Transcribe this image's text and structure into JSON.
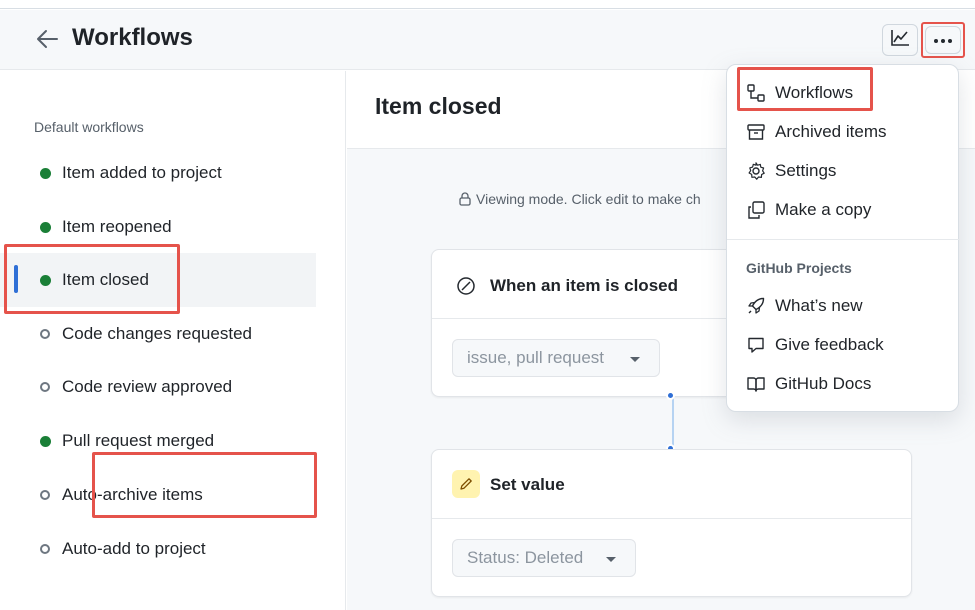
{
  "header": {
    "title": "Workflows",
    "back_icon": "arrow-left-icon",
    "insights_icon": "graph-icon",
    "more_icon": "kebab-horizontal-icon"
  },
  "sidebar": {
    "section_label": "Default workflows",
    "items": [
      {
        "label": "Item added to project",
        "enabled": true
      },
      {
        "label": "Item reopened",
        "enabled": true
      },
      {
        "label": "Item closed",
        "enabled": true,
        "active": true
      },
      {
        "label": "Code changes requested",
        "enabled": false
      },
      {
        "label": "Code review approved",
        "enabled": false
      },
      {
        "label": "Pull request merged",
        "enabled": true
      },
      {
        "label": "Auto-archive items",
        "enabled": false
      },
      {
        "label": "Auto-add to project",
        "enabled": false
      }
    ]
  },
  "main": {
    "title": "Item closed",
    "viewing_mode": "Viewing mode. Click edit to make ch",
    "trigger_card": {
      "title": "When an item is closed",
      "select_value": "issue, pull request"
    },
    "action_card": {
      "title": "Set value",
      "select_value": "Status: Deleted"
    }
  },
  "menu": {
    "items": [
      {
        "label": "Workflows",
        "icon": "workflow-icon"
      },
      {
        "label": "Archived items",
        "icon": "archive-icon"
      },
      {
        "label": "Settings",
        "icon": "gear-icon"
      },
      {
        "label": "Make a copy",
        "icon": "copy-icon"
      }
    ],
    "group_label": "GitHub Projects",
    "group_items": [
      {
        "label": "What’s new",
        "icon": "rocket-icon"
      },
      {
        "label": "Give feedback",
        "icon": "comment-icon"
      },
      {
        "label": "GitHub Docs",
        "icon": "book-icon"
      }
    ]
  },
  "colors": {
    "enabled_dot": "#1a7f37",
    "highlight": "#e5534b",
    "accent": "#2f6fd6"
  }
}
